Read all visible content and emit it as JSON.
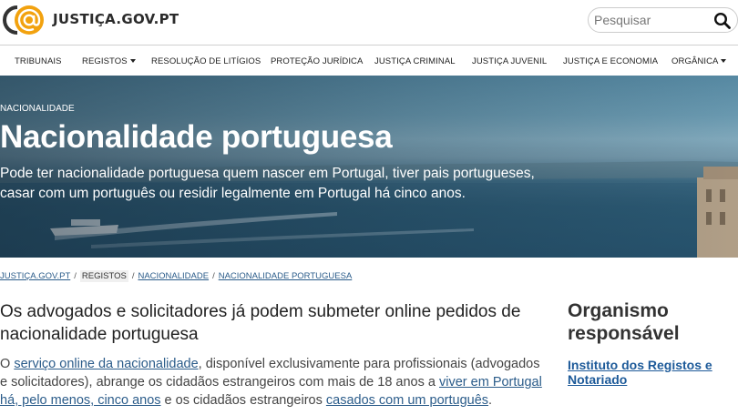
{
  "header": {
    "site_name": "JUSTIÇA.GOV.PT",
    "search_placeholder": "Pesquisar",
    "logo_icon": "at-sign-logo-icon",
    "search_icon": "search-icon"
  },
  "nav": {
    "items": [
      {
        "label": "TRIBUNAIS",
        "dropdown": false
      },
      {
        "label": "REGISTOS",
        "dropdown": true
      },
      {
        "label": "RESOLUÇÃO DE LITÍGIOS",
        "dropdown": false
      },
      {
        "label": "PROTEÇÃO JURÍDICA",
        "dropdown": false
      },
      {
        "label": "JUSTIÇA CRIMINAL",
        "dropdown": false
      },
      {
        "label": "JUSTIÇA JUVENIL",
        "dropdown": false
      },
      {
        "label": "JUSTIÇA E ECONOMIA",
        "dropdown": false
      },
      {
        "label": "ORGÂNICA",
        "dropdown": true
      }
    ]
  },
  "hero": {
    "tag": "NACIONALIDADE",
    "title": "Nacionalidade portuguesa",
    "description": "Pode ter nacionalidade portuguesa quem nascer em Portugal, tiver pais portugueses, casar com um português ou residir legalmente em Portugal há cinco anos."
  },
  "breadcrumb": {
    "items": [
      "JUSTIÇA.GOV.PT",
      "REGISTOS",
      "NACIONALIDADE",
      "NACIONALIDADE PORTUGUESA"
    ]
  },
  "main": {
    "title": "Os advogados e solicitadores já podem submeter online pedidos de nacionalidade portuguesa",
    "p_start": "O ",
    "link1": "serviço online da nacionalidade",
    "p_mid1": ", disponível exclusivamente para profissionais (advogados e solicitadores), abrange os cidadãos estrangeiros com mais de 18 anos a ",
    "link2": "viver em Portugal há, pelo menos, cinco anos",
    "p_mid2": " e os cidadãos estrangeiros ",
    "link3": "casados com um português",
    "p_end": "."
  },
  "sidebar": {
    "title": "Organismo responsável",
    "link": "Instituto dos Registos e Notariado"
  },
  "colors": {
    "logo_orange": "#f2a20f",
    "link_blue": "#2b5c8a",
    "sidebar_link": "#1d5a99"
  }
}
